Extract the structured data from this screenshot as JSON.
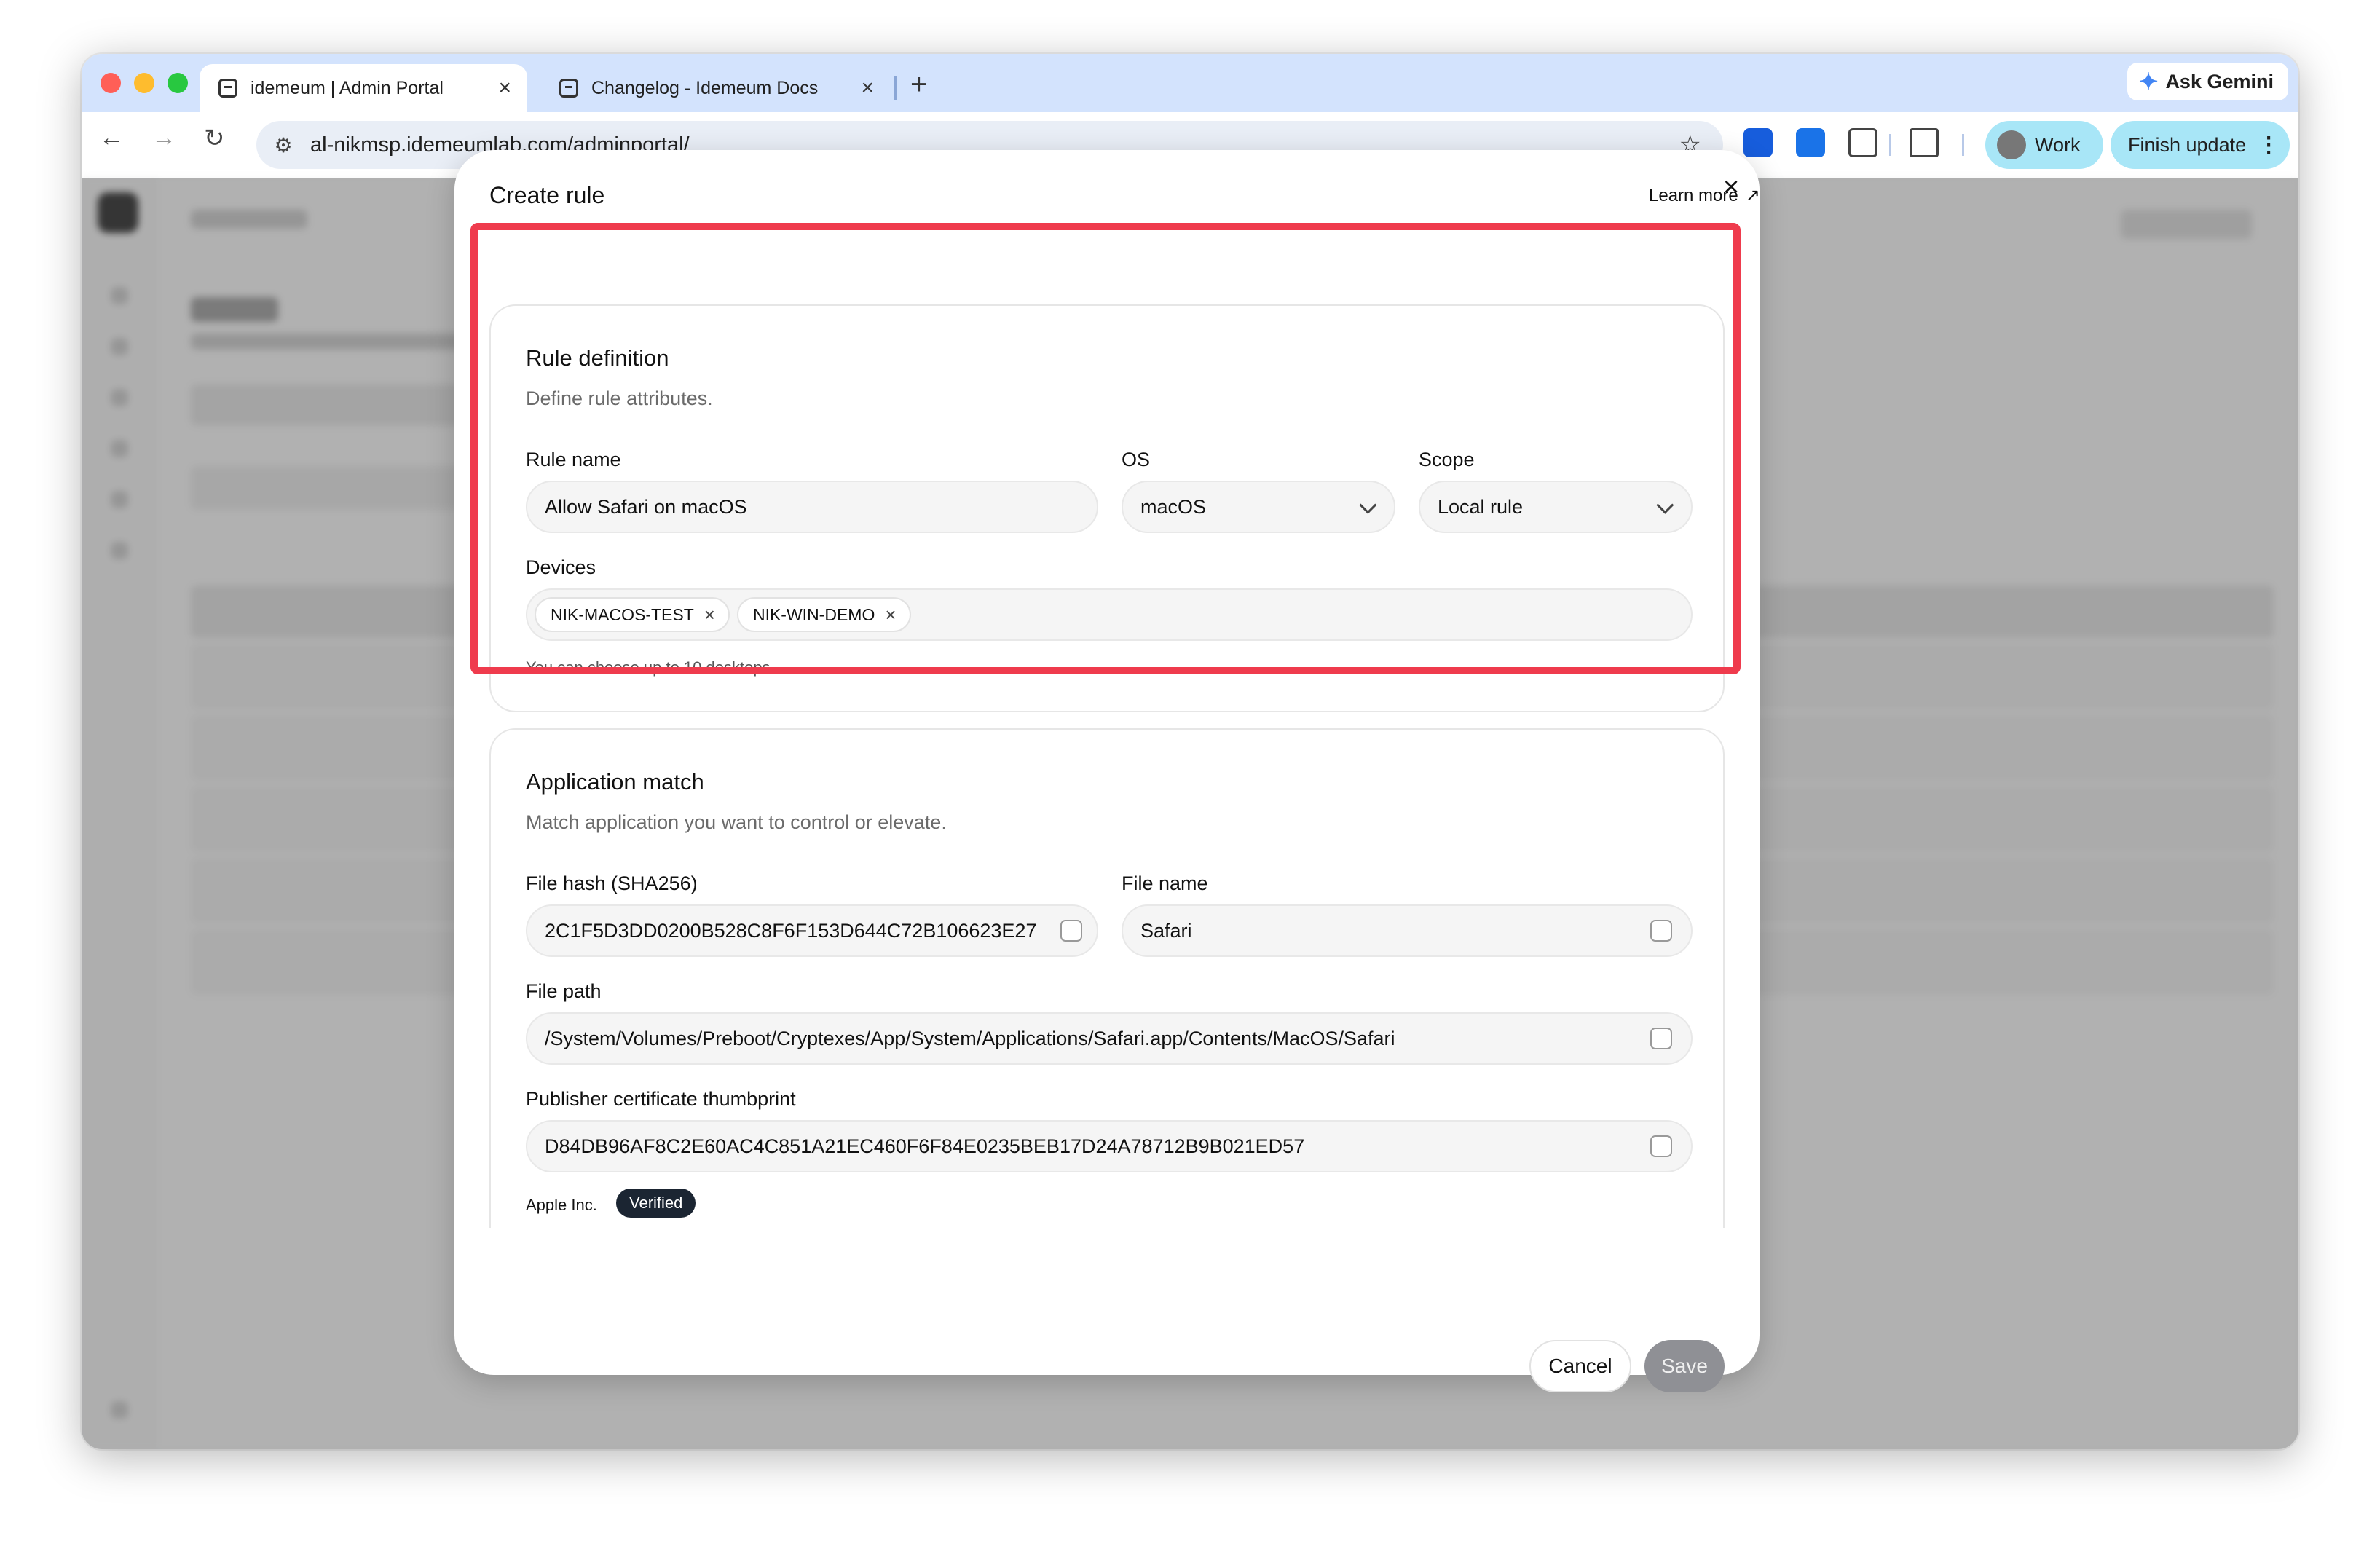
{
  "browser": {
    "tabs": [
      {
        "title": "idemeum | Admin Portal",
        "active": true
      },
      {
        "title": "Changelog - Idemeum Docs",
        "active": false
      }
    ],
    "new_tab_glyph": "+",
    "close_glyph": "×",
    "ask_gemini_label": "Ask Gemini",
    "url": "al-nikmsp.idemeumlab.com/adminportal/",
    "profile_label": "Work",
    "finish_update_label": "Finish update"
  },
  "modal": {
    "title": "Create rule",
    "learn_more": "Learn more",
    "close_glyph": "×",
    "rule_definition": {
      "title": "Rule definition",
      "subtitle": "Define rule attributes.",
      "rule_name_label": "Rule name",
      "rule_name_value": "Allow Safari on macOS",
      "os_label": "OS",
      "os_value": "macOS",
      "scope_label": "Scope",
      "scope_value": "Local rule",
      "devices_label": "Devices",
      "devices": [
        "NIK-MACOS-TEST",
        "NIK-WIN-DEMO"
      ],
      "devices_hint": "You can choose up to 10 desktops."
    },
    "application_match": {
      "title": "Application match",
      "subtitle": "Match application you want to control or elevate.",
      "file_hash_label": "File hash (SHA256)",
      "file_hash_value": "2C1F5D3DD0200B528C8F6F153D644C72B106623E27",
      "file_name_label": "File name",
      "file_name_value": "Safari",
      "file_path_label": "File path",
      "file_path_value": "/System/Volumes/Preboot/Cryptexes/App/System/Applications/Safari.app/Contents/MacOS/Safari",
      "publisher_label": "Publisher certificate thumbprint",
      "publisher_value": "D84DB96AF8C2E60AC4C851A21EC460F6F84E0235BEB17D24A78712B9B021ED57",
      "publisher_name": "Apple Inc.",
      "verified_badge": "Verified"
    },
    "cancel_label": "Cancel",
    "save_label": "Save"
  },
  "colors": {
    "highlight_border": "#ef3b4d",
    "verified_badge_bg": "#1b2532",
    "save_disabled_bg": "#8f9095",
    "profile_chip_bg": "#a8e6f7"
  }
}
